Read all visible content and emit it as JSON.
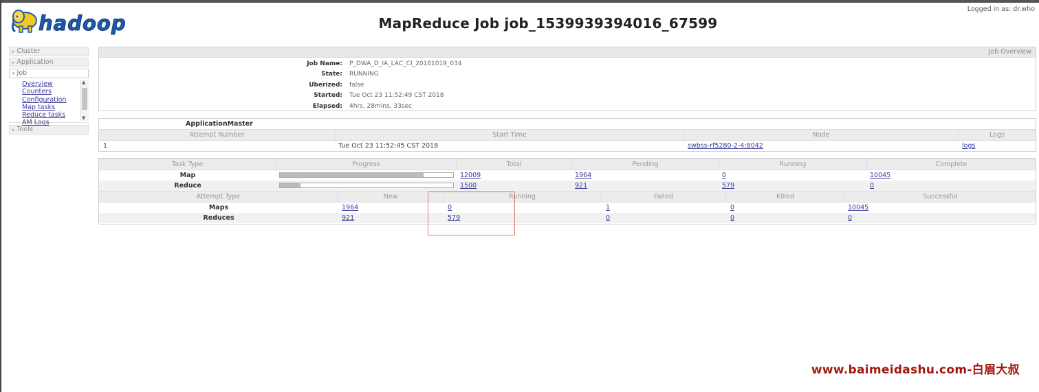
{
  "header": {
    "logo_text": "hadoop",
    "title": "MapReduce Job job_1539939394016_67599",
    "logged_in": "Logged in as: dr.who"
  },
  "sidebar": {
    "cluster": "Cluster",
    "application": "Application",
    "job": "Job",
    "job_links": [
      "Overview",
      "Counters",
      "Configuration",
      "Map tasks",
      "Reduce tasks",
      "AM Logs"
    ],
    "tools": "Tools"
  },
  "overview": {
    "header": "Job Overview",
    "rows": [
      {
        "label": "Job Name:",
        "value": "P_DWA_D_IA_LAC_CI_20181019_034"
      },
      {
        "label": "State:",
        "value": "RUNNING"
      },
      {
        "label": "Uberized:",
        "value": "false"
      },
      {
        "label": "Started:",
        "value": "Tue Oct 23 11:52:49 CST 2018"
      },
      {
        "label": "Elapsed:",
        "value": "4hrs, 28mins, 33sec"
      }
    ]
  },
  "am": {
    "title": "ApplicationMaster",
    "headers": [
      "Attempt Number",
      "Start Time",
      "Node",
      "Logs"
    ],
    "row": {
      "attempt": "1",
      "start_time": "Tue Oct 23 11:52:45 CST 2018",
      "node": "swbss-rf5280-2-4:8042",
      "logs": "logs"
    }
  },
  "tasks": {
    "headers": [
      "Task Type",
      "Progress",
      "Total",
      "Pending",
      "Running",
      "Complete"
    ],
    "rows": [
      {
        "type": "Map",
        "progress_pct": 83,
        "total": "12009",
        "pending": "1964",
        "running": "0",
        "complete": "10045"
      },
      {
        "type": "Reduce",
        "progress_pct": 12,
        "total": "1500",
        "pending": "921",
        "running": "579",
        "complete": "0"
      }
    ]
  },
  "attempts": {
    "headers": [
      "Attempt Type",
      "New",
      "Running",
      "Failed",
      "Killed",
      "Successful"
    ],
    "rows": [
      {
        "type": "Maps",
        "new": "1964",
        "running": "0",
        "failed": "1",
        "killed": "0",
        "successful": "10045"
      },
      {
        "type": "Reduces",
        "new": "921",
        "running": "579",
        "failed": "0",
        "killed": "0",
        "successful": "0"
      }
    ]
  },
  "watermark": "www.baimeidashu.com-白眉大叔",
  "colors": {
    "link": "#3a3a9a",
    "highlight": "#e07a7a",
    "watermark": "#a01810",
    "logo_blue": "#1f5aa8",
    "logo_yellow": "#f2c81e"
  }
}
